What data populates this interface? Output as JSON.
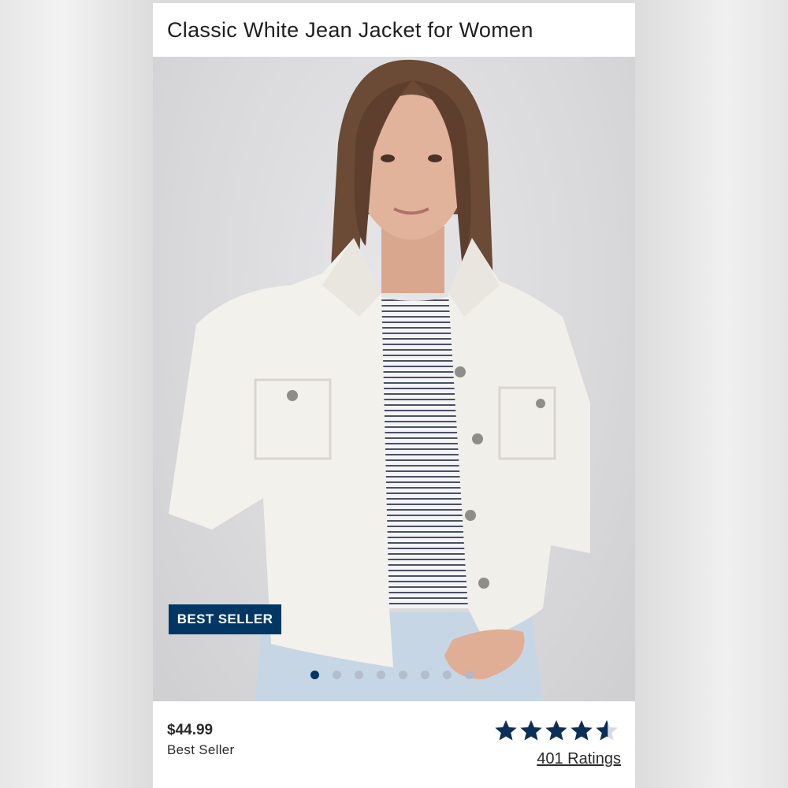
{
  "product": {
    "title": "Classic White Jean Jacket for Women",
    "badge": "BEST SELLER",
    "price": "$44.99",
    "price_label": "Best Seller",
    "rating_value": 4.5,
    "rating_max": 5,
    "ratings_link": "401 Ratings"
  },
  "carousel": {
    "count": 8,
    "active_index": 0
  },
  "colors": {
    "brand_navy": "#003764",
    "text": "#2a2a2a"
  },
  "icons": {
    "star": "star-icon",
    "half_star": "half-star-icon"
  }
}
